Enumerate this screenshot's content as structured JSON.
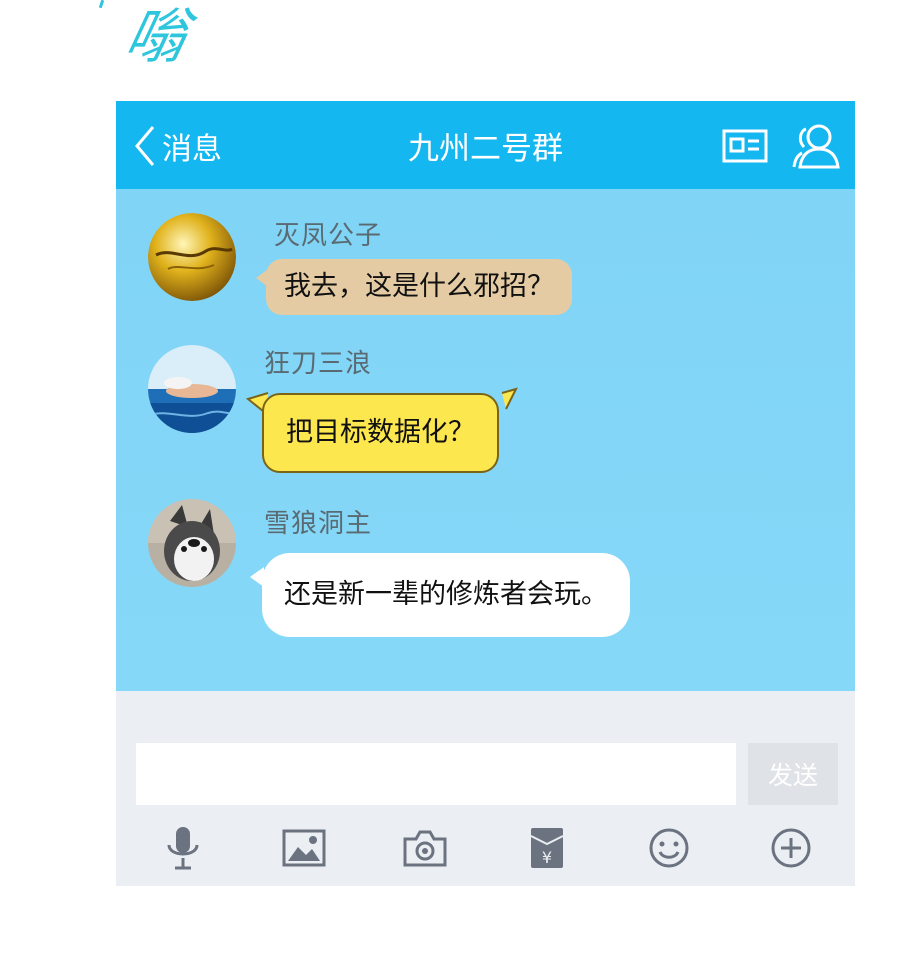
{
  "comic": {
    "sfx": "嗡"
  },
  "header": {
    "back_label": "消息",
    "title": "九州二号群"
  },
  "messages": [
    {
      "sender": "灭凤公子",
      "text": "我去，这是什么邪招？"
    },
    {
      "sender": "狂刀三浪",
      "text": "把目标数据化？"
    },
    {
      "sender": "雪狼洞主",
      "text": "还是新一辈的修炼者会玩。"
    }
  ],
  "composer": {
    "input_value": "",
    "send_label": "发送"
  },
  "toolbar": {
    "icons": [
      "microphone-icon",
      "image-icon",
      "camera-icon",
      "red-envelope-icon",
      "emoji-icon",
      "plus-icon"
    ],
    "envelope_symbol": "¥"
  },
  "colors": {
    "header": "#15b7f0",
    "chat_bg": "#82d6f7",
    "bubble_tan": "#e4cba3",
    "bubble_yellow": "#fde74f",
    "bubble_white": "#ffffff",
    "icon_gray": "#6b7280"
  }
}
